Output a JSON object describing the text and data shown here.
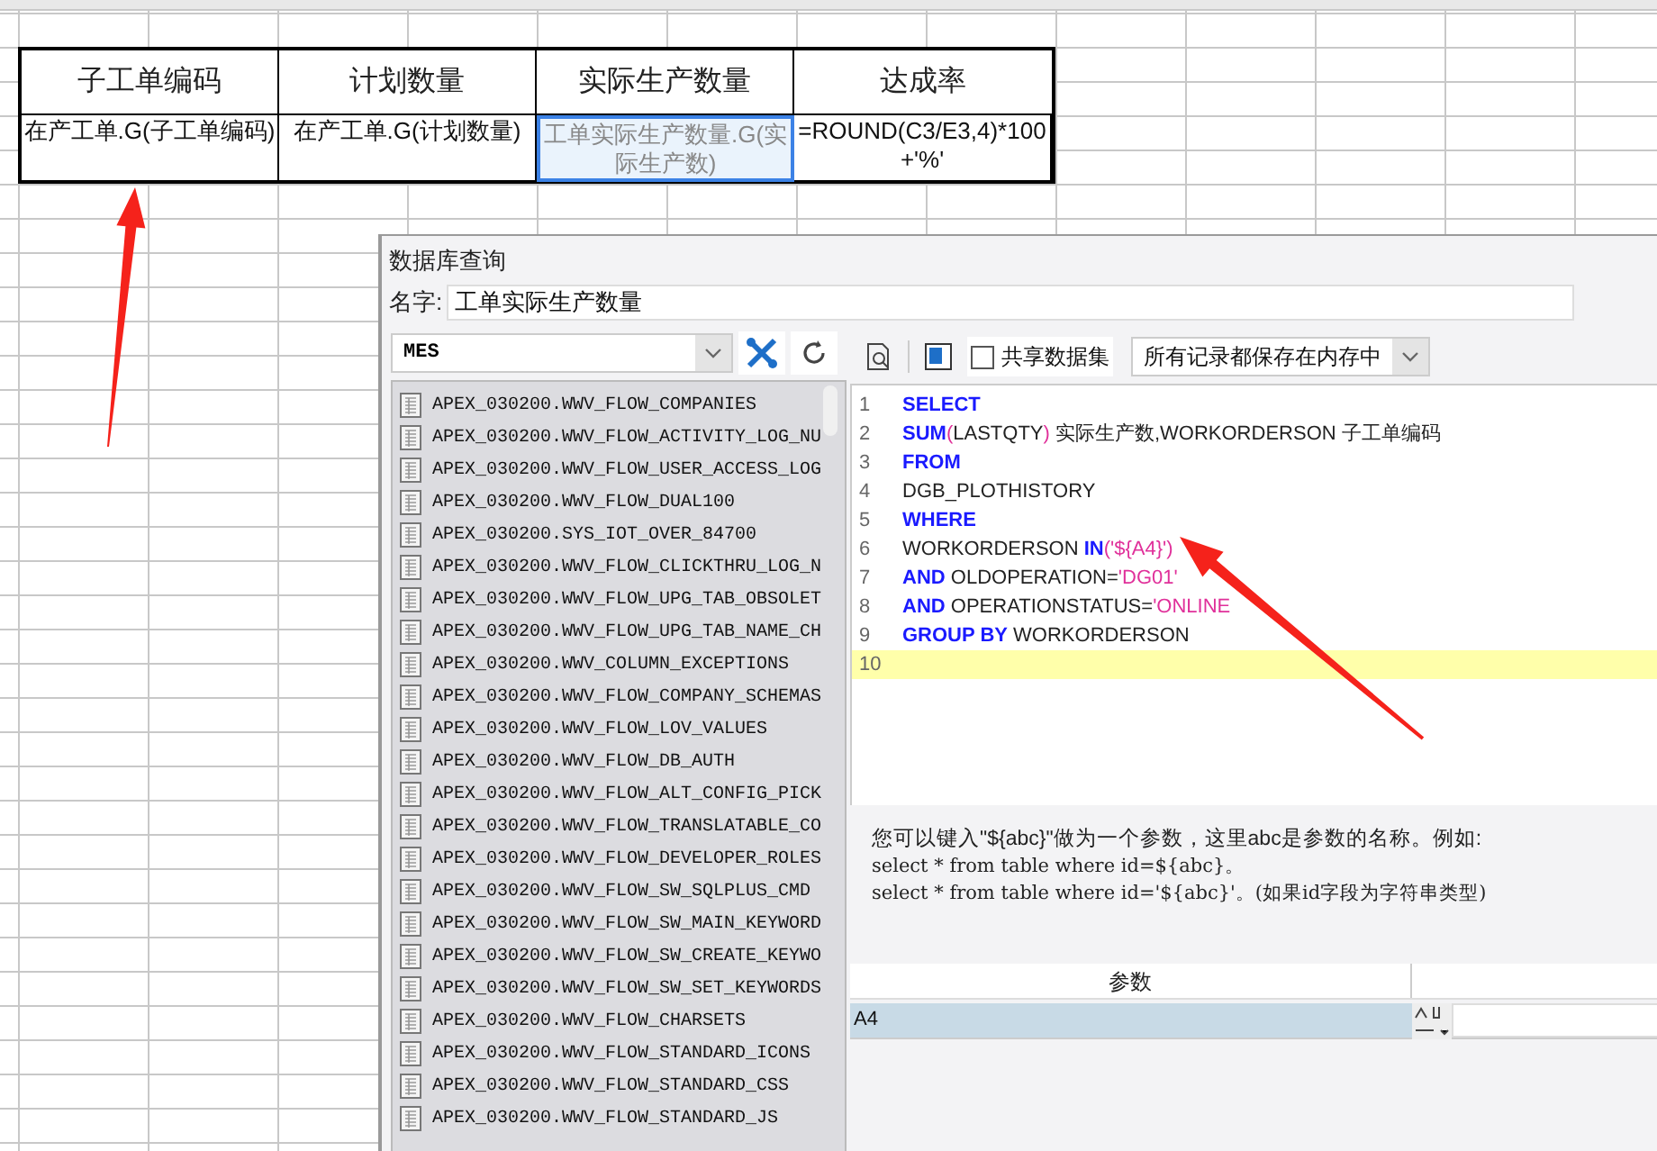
{
  "spreadsheet": {
    "header_row": [
      "子工单编码",
      "计划数量",
      "实际生产数量",
      "达成率"
    ],
    "data_row": [
      {
        "text": "在产工单.G(子工单编码)",
        "selected": false
      },
      {
        "text": "在产工单.G(计划数量)",
        "selected": false
      },
      {
        "text": "工单实际生产数量.G(实际生产数)",
        "selected": true
      },
      {
        "text": "=ROUND(C3/E3,4)*100+'%'",
        "selected": false
      }
    ]
  },
  "dialog": {
    "title": "数据库查询",
    "name_label": "名字:",
    "name_value": "工单实际生产数量",
    "connection": "MES",
    "tables": [
      "APEX_030200.WWV_FLOW_COMPANIES",
      "APEX_030200.WWV_FLOW_ACTIVITY_LOG_NU",
      "APEX_030200.WWV_FLOW_USER_ACCESS_LOG",
      "APEX_030200.WWV_FLOW_DUAL100",
      "APEX_030200.SYS_IOT_OVER_84700",
      "APEX_030200.WWV_FLOW_CLICKTHRU_LOG_N",
      "APEX_030200.WWV_FLOW_UPG_TAB_OBSOLET",
      "APEX_030200.WWV_FLOW_UPG_TAB_NAME_CH",
      "APEX_030200.WWV_COLUMN_EXCEPTIONS",
      "APEX_030200.WWV_FLOW_COMPANY_SCHEMAS",
      "APEX_030200.WWV_FLOW_LOV_VALUES",
      "APEX_030200.WWV_FLOW_DB_AUTH",
      "APEX_030200.WWV_FLOW_ALT_CONFIG_PICK",
      "APEX_030200.WWV_FLOW_TRANSLATABLE_CO",
      "APEX_030200.WWV_FLOW_DEVELOPER_ROLES",
      "APEX_030200.WWV_FLOW_SW_SQLPLUS_CMD",
      "APEX_030200.WWV_FLOW_SW_MAIN_KEYWORD",
      "APEX_030200.WWV_FLOW_SW_CREATE_KEYWO",
      "APEX_030200.WWV_FLOW_SW_SET_KEYWORDS",
      "APEX_030200.WWV_FLOW_CHARSETS",
      "APEX_030200.WWV_FLOW_STANDARD_ICONS",
      "APEX_030200.WWV_FLOW_STANDARD_CSS",
      "APEX_030200.WWV_FLOW_STANDARD_JS"
    ],
    "toolbar": {
      "share_label": "共享数据集",
      "share_checked": false,
      "cache_mode": "所有记录都保存在内存中"
    },
    "sql_lines": [
      {
        "number": "1",
        "current": false,
        "tokens": [
          {
            "kind": "keyword",
            "text": "SELECT"
          }
        ]
      },
      {
        "number": "2",
        "current": false,
        "tokens": [
          {
            "kind": "keyword",
            "text": "SUM"
          },
          {
            "kind": "string",
            "text": "("
          },
          {
            "kind": "plain",
            "text": "LASTQTY"
          },
          {
            "kind": "string",
            "text": ")"
          },
          {
            "kind": "plain",
            "text": " 实际生产数,WORKORDERSON 子工单编码"
          }
        ]
      },
      {
        "number": "3",
        "current": false,
        "tokens": [
          {
            "kind": "keyword",
            "text": "FROM"
          }
        ]
      },
      {
        "number": "4",
        "current": false,
        "tokens": [
          {
            "kind": "plain",
            "text": "DGB_PLOTHISTORY"
          }
        ]
      },
      {
        "number": "5",
        "current": false,
        "tokens": [
          {
            "kind": "keyword",
            "text": "WHERE"
          }
        ]
      },
      {
        "number": "6",
        "current": false,
        "tokens": [
          {
            "kind": "plain",
            "text": "WORKORDERSON "
          },
          {
            "kind": "keyword",
            "text": "IN"
          },
          {
            "kind": "string",
            "text": "('${A4}')"
          }
        ]
      },
      {
        "number": "7",
        "current": false,
        "tokens": [
          {
            "kind": "keyword",
            "text": "AND"
          },
          {
            "kind": "plain",
            "text": " OLDOPERATION="
          },
          {
            "kind": "string",
            "text": "'DG01'"
          }
        ]
      },
      {
        "number": "8",
        "current": false,
        "tokens": [
          {
            "kind": "keyword",
            "text": "AND"
          },
          {
            "kind": "plain",
            "text": " OPERATIONSTATUS="
          },
          {
            "kind": "string",
            "text": "'ONLINE"
          }
        ]
      },
      {
        "number": "9",
        "current": false,
        "tokens": [
          {
            "kind": "keyword",
            "text": "GROUP BY"
          },
          {
            "kind": "plain",
            "text": " WORKORDERSON"
          }
        ]
      },
      {
        "number": "10",
        "current": true
      }
    ],
    "hint_lines": [
      "您可以键入\"${abc}\"做为一个参数，这里abc是参数的名称。例如:",
      "select * from table where id=${abc}。",
      "select * from table where id='${abc}'。(如果id字段为字符串类型)"
    ],
    "params": {
      "column_1": "参数",
      "rows": [
        {
          "name": "A4",
          "selected": true
        }
      ]
    }
  }
}
